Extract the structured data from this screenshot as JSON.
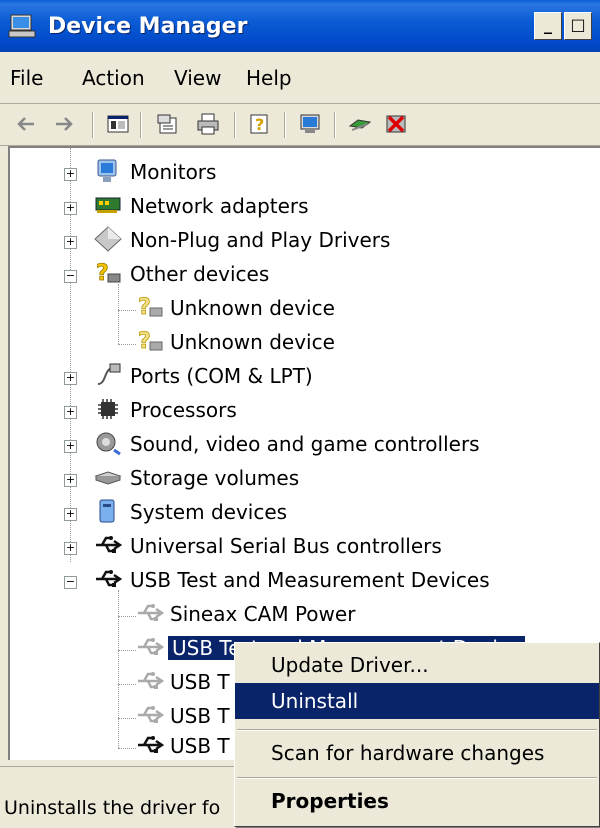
{
  "window": {
    "title": "Device Manager",
    "controls": {
      "minimize": "_",
      "maximize": "□"
    }
  },
  "menu": [
    "File",
    "Action",
    "View",
    "Help"
  ],
  "toolbar": {
    "icons": [
      "back-arrow-icon",
      "forward-arrow-icon",
      "show-hide-console-tree-icon",
      "properties-icon",
      "print-icon",
      "help-icon",
      "scan-hardware-icon",
      "update-driver-icon",
      "uninstall-icon"
    ]
  },
  "tree": {
    "items": [
      {
        "label": "Monitors",
        "icon": "monitor-icon",
        "expander": "+"
      },
      {
        "label": "Network adapters",
        "icon": "network-adapter-icon",
        "expander": "+"
      },
      {
        "label": "Non-Plug and Play Drivers",
        "icon": "non-pnp-driver-icon",
        "expander": "+"
      },
      {
        "label": "Other devices",
        "icon": "unknown-device-icon",
        "expander": "−"
      },
      {
        "label": "Unknown device",
        "icon": "unknown-device-icon"
      },
      {
        "label": "Unknown device",
        "icon": "unknown-device-icon"
      },
      {
        "label": "Ports (COM & LPT)",
        "icon": "port-icon",
        "expander": "+"
      },
      {
        "label": "Processors",
        "icon": "processor-icon",
        "expander": "+"
      },
      {
        "label": "Sound, video and game controllers",
        "icon": "sound-icon",
        "expander": "+"
      },
      {
        "label": "Storage volumes",
        "icon": "storage-icon",
        "expander": "+"
      },
      {
        "label": "System devices",
        "icon": "system-device-icon",
        "expander": "+"
      },
      {
        "label": "Universal Serial Bus controllers",
        "icon": "usb-icon",
        "expander": "+"
      },
      {
        "label": "USB Test and Measurement Devices",
        "icon": "usb-icon",
        "expander": "−"
      },
      {
        "label": "Sineax CAM Power",
        "icon": "usb-icon"
      },
      {
        "label": "USB Test and Measurement Device",
        "icon": "usb-icon",
        "selected": true
      },
      {
        "label": "USB T",
        "icon": "usb-icon"
      },
      {
        "label": "USB T",
        "icon": "usb-icon"
      },
      {
        "label": "USB T",
        "icon": "usb-icon"
      }
    ]
  },
  "context_menu": {
    "items": [
      "Update Driver...",
      "Uninstall",
      "Scan for hardware changes",
      "Properties"
    ],
    "highlighted": "Uninstall"
  },
  "status": {
    "text": "Uninstalls the driver fo"
  },
  "colors": {
    "titlebar": "#0b5cd5",
    "selection": "#0a246a",
    "chrome": "#ece9d8"
  }
}
